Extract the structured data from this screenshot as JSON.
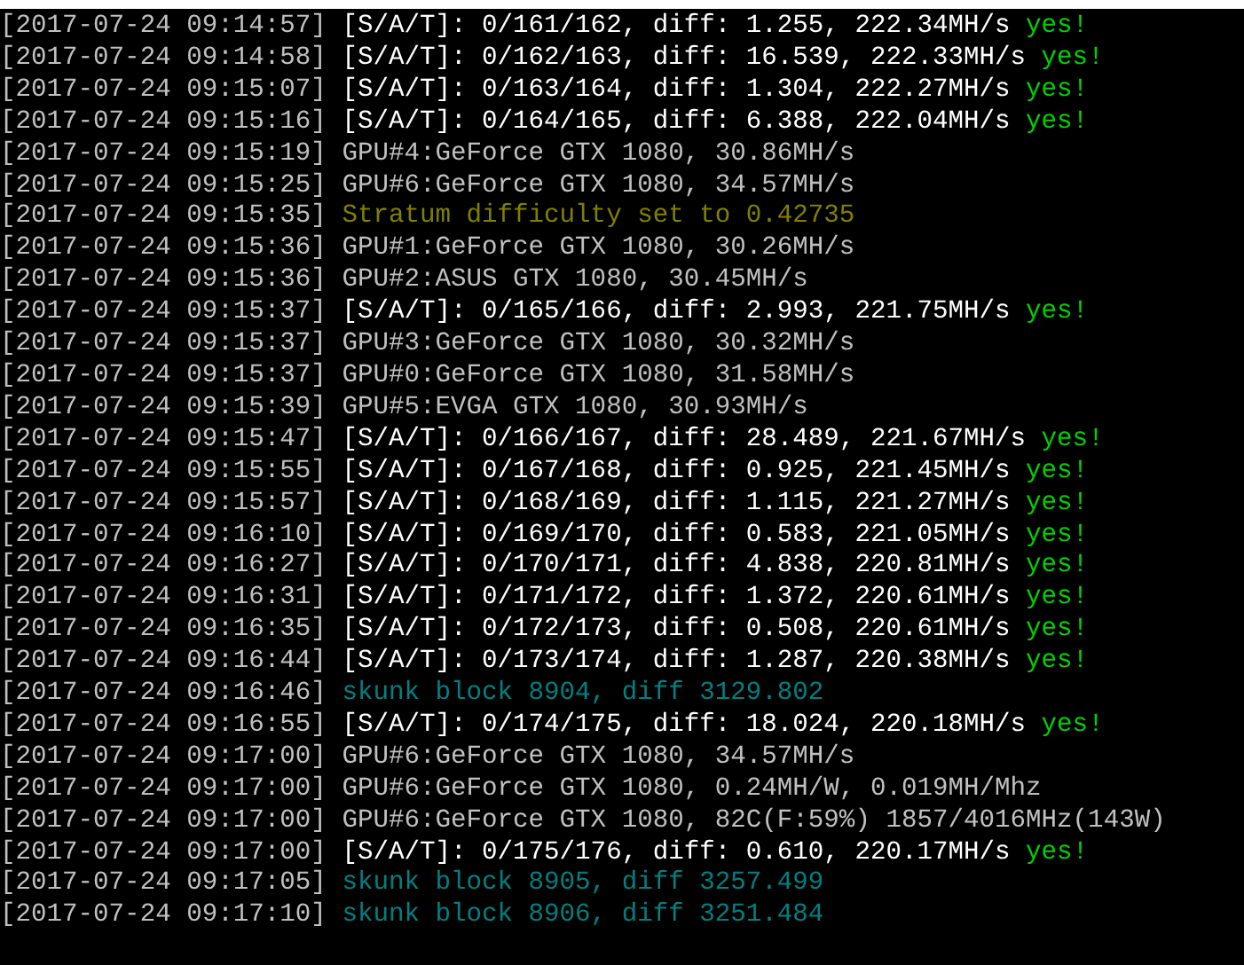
{
  "log": [
    {
      "time": "[2017-07-24 09:14:57]",
      "kind": "share",
      "text": "[S/A/T]: 0/161/162, diff: 1.255, 222.34MH/s",
      "result": "yes!"
    },
    {
      "time": "[2017-07-24 09:14:58]",
      "kind": "share",
      "text": "[S/A/T]: 0/162/163, diff: 16.539, 222.33MH/s",
      "result": "yes!"
    },
    {
      "time": "[2017-07-24 09:15:07]",
      "kind": "share",
      "text": "[S/A/T]: 0/163/164, diff: 1.304, 222.27MH/s",
      "result": "yes!"
    },
    {
      "time": "[2017-07-24 09:15:16]",
      "kind": "share",
      "text": "[S/A/T]: 0/164/165, diff: 6.388, 222.04MH/s",
      "result": "yes!"
    },
    {
      "time": "[2017-07-24 09:15:19]",
      "kind": "gpu",
      "text": "GPU#4:GeForce GTX 1080, 30.86MH/s"
    },
    {
      "time": "[2017-07-24 09:15:25]",
      "kind": "gpu",
      "text": "GPU#6:GeForce GTX 1080, 34.57MH/s"
    },
    {
      "time": "[2017-07-24 09:15:35]",
      "kind": "stratum",
      "text": "Stratum difficulty set to 0.42735"
    },
    {
      "time": "[2017-07-24 09:15:36]",
      "kind": "gpu",
      "text": "GPU#1:GeForce GTX 1080, 30.26MH/s"
    },
    {
      "time": "[2017-07-24 09:15:36]",
      "kind": "gpu",
      "text": "GPU#2:ASUS GTX 1080, 30.45MH/s"
    },
    {
      "time": "[2017-07-24 09:15:37]",
      "kind": "share",
      "text": "[S/A/T]: 0/165/166, diff: 2.993, 221.75MH/s",
      "result": "yes!"
    },
    {
      "time": "[2017-07-24 09:15:37]",
      "kind": "gpu",
      "text": "GPU#3:GeForce GTX 1080, 30.32MH/s"
    },
    {
      "time": "[2017-07-24 09:15:37]",
      "kind": "gpu",
      "text": "GPU#0:GeForce GTX 1080, 31.58MH/s"
    },
    {
      "time": "[2017-07-24 09:15:39]",
      "kind": "gpu",
      "text": "GPU#5:EVGA GTX 1080, 30.93MH/s"
    },
    {
      "time": "[2017-07-24 09:15:47]",
      "kind": "share",
      "text": "[S/A/T]: 0/166/167, diff: 28.489, 221.67MH/s",
      "result": "yes!"
    },
    {
      "time": "[2017-07-24 09:15:55]",
      "kind": "share",
      "text": "[S/A/T]: 0/167/168, diff: 0.925, 221.45MH/s",
      "result": "yes!"
    },
    {
      "time": "[2017-07-24 09:15:57]",
      "kind": "share",
      "text": "[S/A/T]: 0/168/169, diff: 1.115, 221.27MH/s",
      "result": "yes!"
    },
    {
      "time": "[2017-07-24 09:16:10]",
      "kind": "share",
      "text": "[S/A/T]: 0/169/170, diff: 0.583, 221.05MH/s",
      "result": "yes!"
    },
    {
      "time": "[2017-07-24 09:16:27]",
      "kind": "share",
      "text": "[S/A/T]: 0/170/171, diff: 4.838, 220.81MH/s",
      "result": "yes!"
    },
    {
      "time": "[2017-07-24 09:16:31]",
      "kind": "share",
      "text": "[S/A/T]: 0/171/172, diff: 1.372, 220.61MH/s",
      "result": "yes!"
    },
    {
      "time": "[2017-07-24 09:16:35]",
      "kind": "share",
      "text": "[S/A/T]: 0/172/173, diff: 0.508, 220.61MH/s",
      "result": "yes!"
    },
    {
      "time": "[2017-07-24 09:16:44]",
      "kind": "share",
      "text": "[S/A/T]: 0/173/174, diff: 1.287, 220.38MH/s",
      "result": "yes!"
    },
    {
      "time": "[2017-07-24 09:16:46]",
      "kind": "block",
      "text": "skunk block 8904, diff 3129.802"
    },
    {
      "time": "[2017-07-24 09:16:55]",
      "kind": "share",
      "text": "[S/A/T]: 0/174/175, diff: 18.024, 220.18MH/s",
      "result": "yes!"
    },
    {
      "time": "[2017-07-24 09:17:00]",
      "kind": "gpu",
      "text": "GPU#6:GeForce GTX 1080, 34.57MH/s"
    },
    {
      "time": "[2017-07-24 09:17:00]",
      "kind": "gpu",
      "text": "GPU#6:GeForce GTX 1080, 0.24MH/W, 0.019MH/Mhz"
    },
    {
      "time": "[2017-07-24 09:17:00]",
      "kind": "gpu",
      "text": "GPU#6:GeForce GTX 1080, 82C(F:59%) 1857/4016MHz(143W)"
    },
    {
      "time": "[2017-07-24 09:17:00]",
      "kind": "share",
      "text": "[S/A/T]: 0/175/176, diff: 0.610, 220.17MH/s",
      "result": "yes!"
    },
    {
      "time": "[2017-07-24 09:17:05]",
      "kind": "block",
      "text": "skunk block 8905, diff 3257.499"
    },
    {
      "time": "[2017-07-24 09:17:10]",
      "kind": "block",
      "text": "skunk block 8906, diff 3251.484"
    }
  ]
}
